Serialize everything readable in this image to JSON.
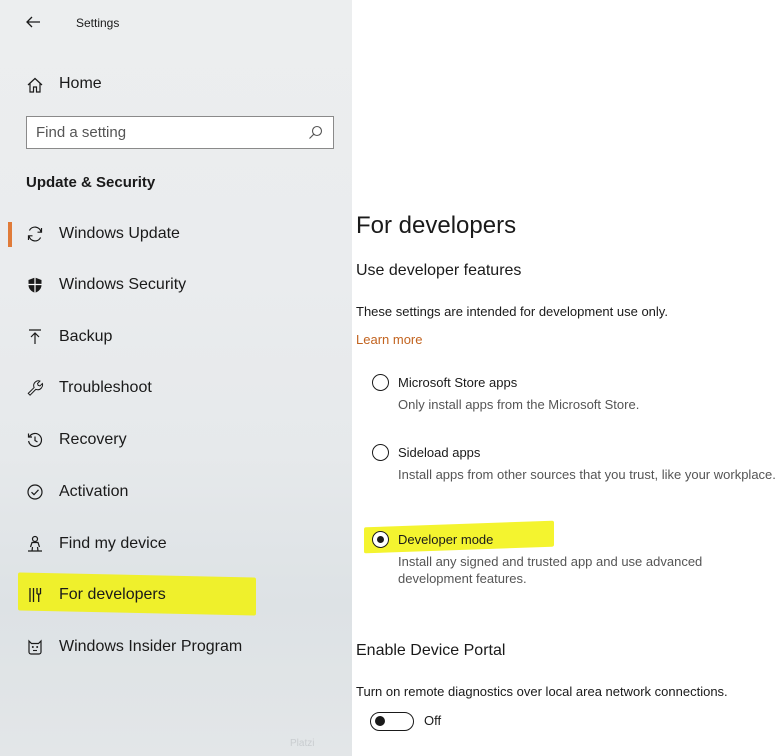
{
  "app": {
    "title": "Settings"
  },
  "sidebar": {
    "home_label": "Home",
    "search": {
      "placeholder": "Find a setting"
    },
    "section_heading": "Update & Security",
    "items": [
      {
        "label": "Windows Update",
        "icon": "refresh-icon",
        "selected_indicator": true
      },
      {
        "label": "Windows Security",
        "icon": "shield-icon"
      },
      {
        "label": "Backup",
        "icon": "backup-arrow-icon"
      },
      {
        "label": "Troubleshoot",
        "icon": "wrench-icon"
      },
      {
        "label": "Recovery",
        "icon": "history-icon"
      },
      {
        "label": "Activation",
        "icon": "check-circle-icon"
      },
      {
        "label": "Find my device",
        "icon": "person-location-icon"
      },
      {
        "label": "For developers",
        "icon": "developer-tools-icon",
        "highlighted": true
      },
      {
        "label": "Windows Insider Program",
        "icon": "insider-cat-icon"
      }
    ],
    "watermark": "Platzi"
  },
  "main": {
    "title": "For developers",
    "subheading": "Use developer features",
    "intro": "These settings are intended for development use only.",
    "learn_more": "Learn more",
    "options": [
      {
        "label": "Microsoft Store apps",
        "description": "Only install apps from the Microsoft Store.",
        "checked": false
      },
      {
        "label": "Sideload apps",
        "description": "Install apps from other sources that you trust, like your workplace.",
        "checked": false
      },
      {
        "label": "Developer mode",
        "description": "Install any signed and trusted app and use advanced development features.",
        "checked": true
      }
    ],
    "portal": {
      "heading": "Enable Device Portal",
      "description": "Turn on remote diagnostics over local area network connections.",
      "toggle_state": "Off"
    }
  },
  "colors": {
    "accent": "#e07b39",
    "link": "#c2631f",
    "highlight": "#f2f20a"
  }
}
